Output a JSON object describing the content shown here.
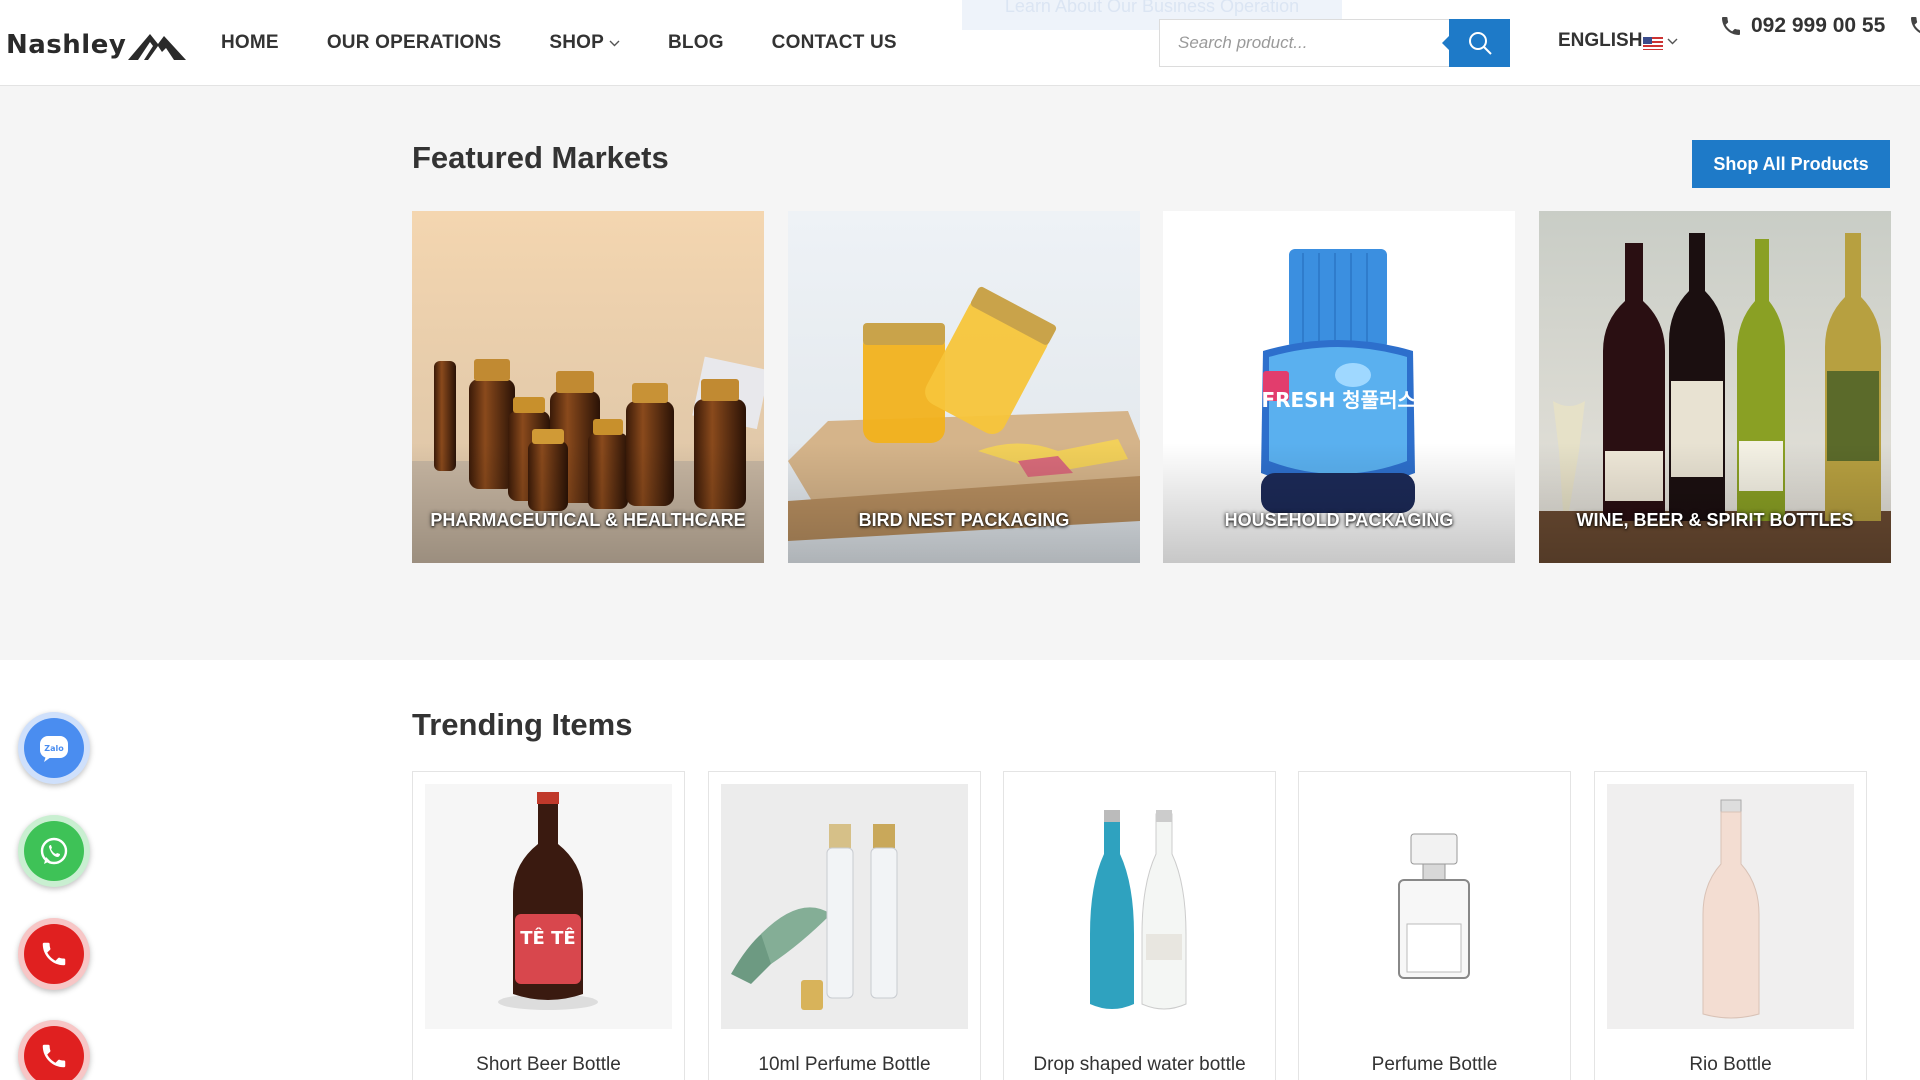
{
  "header": {
    "logo_text": "Nashley",
    "nav": [
      "HOME",
      "OUR OPERATIONS",
      "SHOP",
      "BLOG",
      "CONTACT US"
    ],
    "promo_tab": "Learn About Our Business Operation",
    "search_placeholder": "Search product...",
    "language": "ENGLISH",
    "phone": "092 999 00 55"
  },
  "featured": {
    "title": "Featured Markets",
    "shop_all": "Shop All Products",
    "markets": [
      {
        "label": "PHARMACEUTICAL & HEALTHCARE",
        "icon": "amber-bottles-image"
      },
      {
        "label": "BIRD NEST PACKAGING",
        "icon": "glass-jars-image"
      },
      {
        "label": "HOUSEHOLD PACKAGING",
        "icon": "toilet-cleaner-image",
        "product_text": "Mr.FRESH 청풀러스+향"
      },
      {
        "label": "WINE, BEER & SPIRIT BOTTLES",
        "icon": "wine-bottles-image"
      }
    ]
  },
  "trending": {
    "title": "Trending Items",
    "items": [
      {
        "name": "Short Beer Bottle",
        "label_text": "TÊ TÊ"
      },
      {
        "name": "10ml Perfume Bottle"
      },
      {
        "name": "Drop shaped water bottle"
      },
      {
        "name": "Perfume Bottle"
      },
      {
        "name": "Rio Bottle"
      }
    ]
  },
  "contact_buttons": [
    {
      "icon": "zalo-icon",
      "text": "Zalo",
      "color": "#4a8df0"
    },
    {
      "icon": "whatsapp-icon",
      "color": "#3ec257"
    },
    {
      "icon": "phone-icon",
      "color": "#e02020"
    },
    {
      "icon": "phone-icon",
      "color": "#e02020"
    }
  ],
  "colors": {
    "accent": "#1e7ac8",
    "background": "#f5f5f5"
  }
}
